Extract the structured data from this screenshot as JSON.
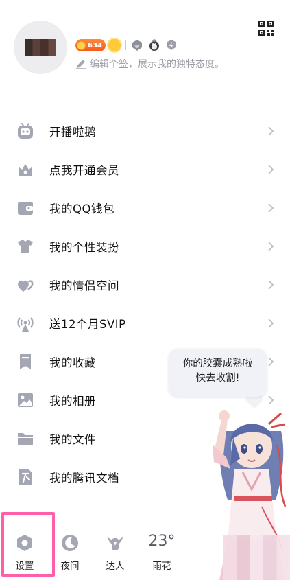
{
  "profile": {
    "coin_count": "634",
    "signature": "编辑个签，展示我的独特态度。",
    "badges": [
      "coin-badge",
      "sun-badge",
      "level-badge",
      "penguin-badge",
      "bolt-badge"
    ]
  },
  "menu": {
    "items": [
      {
        "label": "开播啦鹅",
        "icon": "tv-robot-icon"
      },
      {
        "label": "点我开通会员",
        "icon": "crown-icon"
      },
      {
        "label": "我的QQ钱包",
        "icon": "wallet-icon"
      },
      {
        "label": "我的个性装扮",
        "icon": "shirt-icon"
      },
      {
        "label": "我的情侣空间",
        "icon": "hearts-icon"
      },
      {
        "label": "送12个月SVIP",
        "icon": "antenna-icon"
      },
      {
        "label": "我的收藏",
        "icon": "bookmark-icon"
      },
      {
        "label": "我的相册",
        "icon": "photo-icon"
      },
      {
        "label": "我的文件",
        "icon": "folder-icon"
      },
      {
        "label": "我的腾讯文档",
        "icon": "doc-icon"
      }
    ]
  },
  "bubble": {
    "line1": "你的胶囊成熟啦",
    "line2": "快去收割!"
  },
  "bottom_bar": {
    "settings": "设置",
    "night": "夜间",
    "talent": "达人",
    "weather_temp": "23°",
    "weather": "雨花"
  },
  "colors": {
    "icon_gray": "#a4a6b3",
    "highlight": "#ff5ea8",
    "coin_badge": "#f25a1a"
  }
}
